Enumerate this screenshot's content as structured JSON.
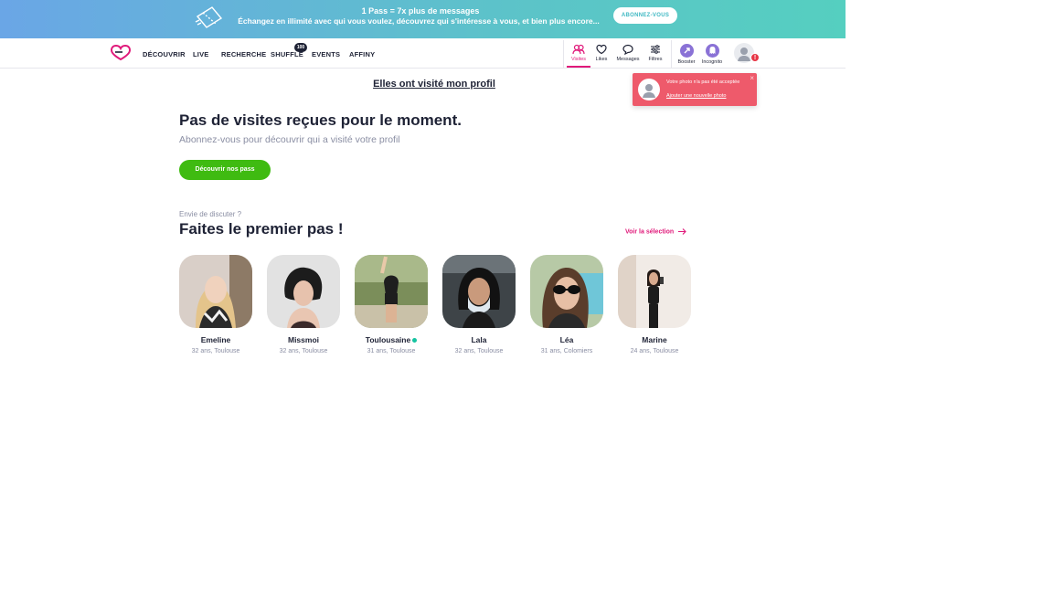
{
  "promo": {
    "title": "1 Pass = 7x plus de messages",
    "subtitle": "Échangez en illimité avec qui vous voulez, découvrez qui s'intéresse à vous, et bien plus encore...",
    "cta": "ABONNEZ-VOUS"
  },
  "nav": {
    "menu": [
      "DÉCOUVRIR",
      "LIVE",
      "RECHERCHE",
      "SHUFFLE",
      "EVENTS",
      "AFFINY"
    ],
    "shuffle_badge": "100",
    "tools": {
      "visites": "Visites",
      "likes": "Likes",
      "messages": "Messages",
      "filtres": "Filtres",
      "booster": "Booster",
      "incognito": "Incognito"
    },
    "avatar_alert": "!"
  },
  "toast": {
    "message": "Votre photo n'a pas été acceptée",
    "link": "Ajouter une nouvelle photo",
    "close": "×"
  },
  "main": {
    "section_title": "Elles ont visité mon profil",
    "empty_title": "Pas de visites reçues pour le moment.",
    "empty_subtitle": "Abonnez-vous pour découvrir qui a visité votre profil",
    "discover_button": "Découvrir nos pass",
    "eyebrow": "Envie de discuter ?",
    "first_step_title": "Faites le premier pas !",
    "see_selection": "Voir la sélection"
  },
  "profiles": [
    {
      "name": "Emeline",
      "meta": "32 ans, Toulouse"
    },
    {
      "name": "Missmoi",
      "meta": "32 ans, Toulouse"
    },
    {
      "name": "Toulousaine",
      "meta": "31 ans, Toulouse"
    },
    {
      "name": "Lala",
      "meta": "32 ans, Toulouse"
    },
    {
      "name": "Léa",
      "meta": "31 ans, Colomiers"
    },
    {
      "name": "Marine",
      "meta": "24 ans, Toulouse"
    }
  ],
  "colors": {
    "accent": "#e0197a",
    "cta_green": "#3fbb11",
    "toast": "#ee5a6b",
    "online": "#14c3a0"
  }
}
